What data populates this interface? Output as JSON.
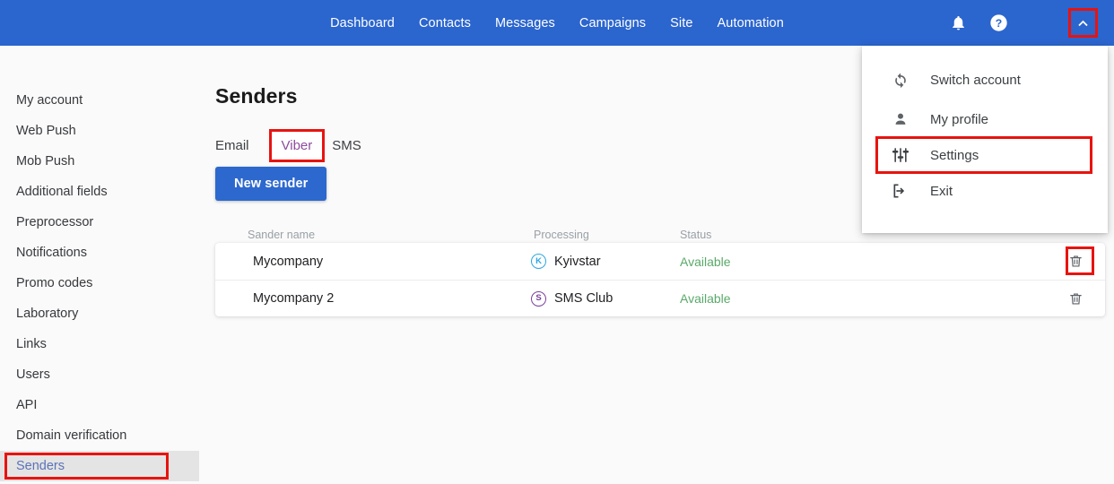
{
  "topbar": {
    "background": "#2b65ce",
    "nav": [
      {
        "label": "Dashboard"
      },
      {
        "label": "Contacts"
      },
      {
        "label": "Messages"
      },
      {
        "label": "Campaigns"
      },
      {
        "label": "Site"
      },
      {
        "label": "Automation"
      }
    ],
    "icons": {
      "notifications": "bell-icon",
      "help": "help-circle-icon",
      "account_toggle": "chevron-up-icon"
    }
  },
  "account_menu": {
    "items": [
      {
        "label": "Switch account",
        "icon": "sync-icon",
        "highlighted": false
      },
      {
        "label": "My profile",
        "icon": "person-icon",
        "highlighted": false
      },
      {
        "label": "Settings",
        "icon": "sliders-icon",
        "highlighted": true
      },
      {
        "label": "Exit",
        "icon": "logout-icon",
        "highlighted": false
      }
    ]
  },
  "sidebar": {
    "items": [
      {
        "label": "My account",
        "active": false
      },
      {
        "label": "Web Push",
        "active": false
      },
      {
        "label": "Mob Push",
        "active": false
      },
      {
        "label": "Additional fields",
        "active": false
      },
      {
        "label": "Preprocessor",
        "active": false
      },
      {
        "label": "Notifications",
        "active": false
      },
      {
        "label": "Promo codes",
        "active": false
      },
      {
        "label": "Laboratory",
        "active": false
      },
      {
        "label": "Links",
        "active": false
      },
      {
        "label": "Users",
        "active": false
      },
      {
        "label": "API",
        "active": false
      },
      {
        "label": "Domain verification",
        "active": false
      },
      {
        "label": "Senders",
        "active": true
      }
    ]
  },
  "main": {
    "title": "Senders",
    "tabs": [
      {
        "label": "Email",
        "selected": false,
        "highlighted": false
      },
      {
        "label": "Viber",
        "selected": true,
        "highlighted": true
      },
      {
        "label": "SMS",
        "selected": false,
        "highlighted": false
      }
    ],
    "new_sender_label": "New sender",
    "table": {
      "columns": [
        "Sander name",
        "Processing",
        "Status"
      ],
      "rows": [
        {
          "name": "Mycompany",
          "processing": "Kyivstar",
          "processing_initial": "K",
          "status": "Available",
          "delete_icon": "trash-icon",
          "delete_highlighted": true
        },
        {
          "name": "Mycompany 2",
          "processing": "SMS Club",
          "processing_initial": "S",
          "status": "Available",
          "delete_icon": "trash-icon",
          "delete_highlighted": false
        }
      ]
    }
  },
  "colors": {
    "header_blue": "#2b65ce",
    "button_blue": "#2d68ce",
    "highlight_red": "#e8130f",
    "status_green": "#5aa96a",
    "viber_purple": "#8e4b9e",
    "kyivstar_blue": "#2aa8e0",
    "smsclub_purple": "#7b3fa0",
    "sidebar_active_bg": "#e4e4e4",
    "sidebar_active_text": "#5a73b8"
  }
}
